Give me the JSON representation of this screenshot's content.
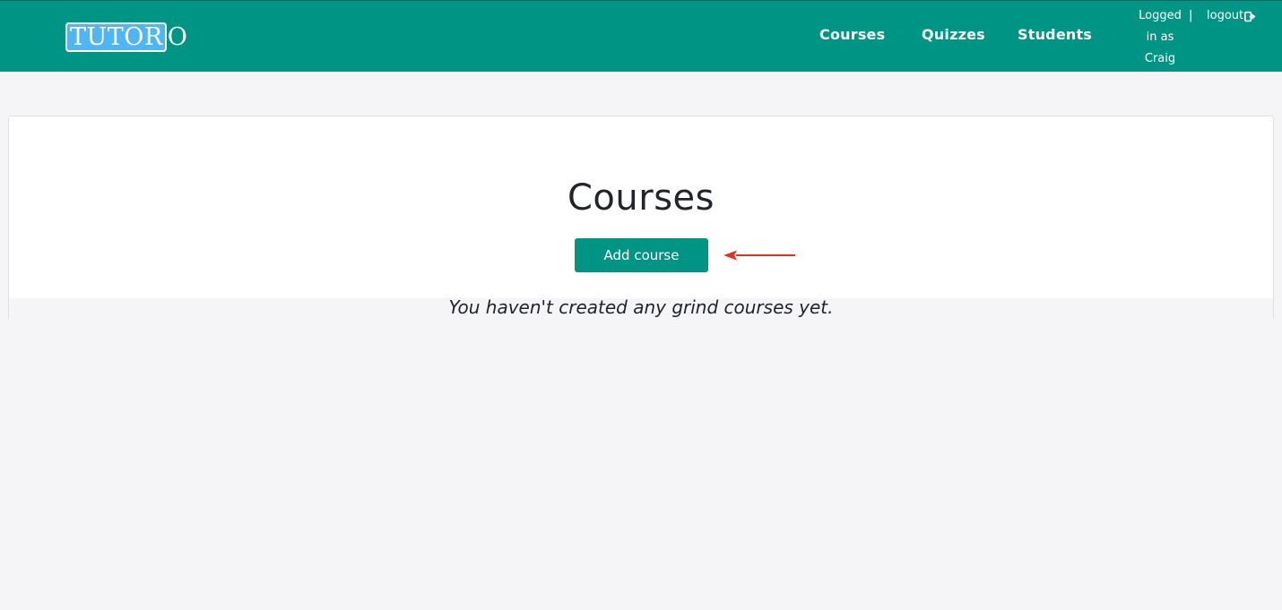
{
  "brand": {
    "logo_boxed": "TUTOR",
    "logo_tail": "O"
  },
  "nav": {
    "items": [
      {
        "label": "Courses"
      },
      {
        "label": "Quizzes"
      },
      {
        "label": "Students"
      }
    ],
    "user": {
      "line1": "Logged",
      "line2": "in as",
      "line3": "Craig"
    },
    "separator": "|",
    "logout_label": "logout",
    "logout_icon": "logout-icon"
  },
  "main": {
    "title": "Courses",
    "add_button_label": "Add course",
    "empty_message": "You haven't created any grind courses yet."
  },
  "colors": {
    "primary": "#009485",
    "logo_highlight": "#4fb6f5",
    "annotation_arrow": "#e8301c",
    "background": "#f5f5f7"
  }
}
